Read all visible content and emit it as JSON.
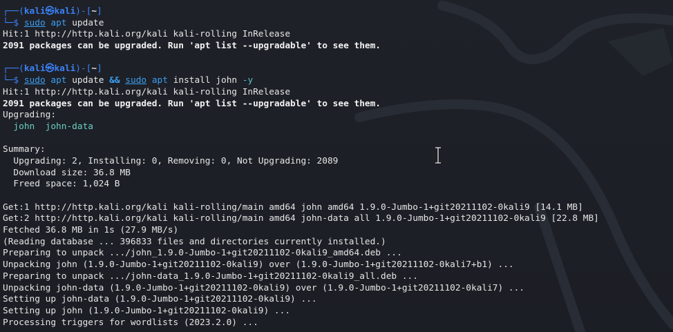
{
  "prompt1": {
    "frame_top": "┌──(",
    "user": "kali",
    "at": "㉿",
    "host": "kali",
    "mid": ")-[",
    "cwd": "~",
    "end": "]",
    "frame_bottom": "└─$ ",
    "sudo": "sudo",
    "apt": "apt",
    "args": "update"
  },
  "block1": [
    "Hit:1 http://http.kali.org/kali kali-rolling InRelease",
    "2091 packages can be upgraded. Run 'apt list --upgradable' to see them."
  ],
  "prompt2": {
    "frame_top": "┌──(",
    "user": "kali",
    "at": "㉿",
    "host": "kali",
    "mid": ")-[",
    "cwd": "~",
    "end": "]",
    "frame_bottom": "└─$ ",
    "sudo1": "sudo",
    "apt1": "apt",
    "args1": " update ",
    "op": "&&",
    "sudo2": "sudo",
    "apt2": "apt",
    "args2": " install john ",
    "flag": "-y"
  },
  "block2": {
    "hit": "Hit:1 http://http.kali.org/kali kali-rolling InRelease",
    "upgradable": "2091 packages can be upgraded. Run 'apt list --upgradable' to see them.",
    "upgrading_label": "Upgrading:",
    "upgrading_pkgs": "  john  john-data",
    "summary_label": "Summary:",
    "summary_lines": [
      "  Upgrading: 2, Installing: 0, Removing: 0, Not Upgrading: 2089",
      "  Download size: 36.8 MB",
      "  Freed space: 1,024 B"
    ],
    "output_lines": [
      "Get:1 http://http.kali.org/kali kali-rolling/main amd64 john amd64 1.9.0-Jumbo-1+git20211102-0kali9 [14.1 MB]",
      "Get:2 http://http.kali.org/kali kali-rolling/main amd64 john-data all 1.9.0-Jumbo-1+git20211102-0kali9 [22.8 MB]",
      "Fetched 36.8 MB in 1s (27.9 MB/s)",
      "(Reading database ... 396833 files and directories currently installed.)",
      "Preparing to unpack .../john_1.9.0-Jumbo-1+git20211102-0kali9_amd64.deb ...",
      "Unpacking john (1.9.0-Jumbo-1+git20211102-0kali9) over (1.9.0-Jumbo-1+git20211102-0kali7+b1) ...",
      "Preparing to unpack .../john-data_1.9.0-Jumbo-1+git20211102-0kali9_all.deb ...",
      "Unpacking john-data (1.9.0-Jumbo-1+git20211102-0kali9) over (1.9.0-Jumbo-1+git20211102-0kali7) ...",
      "Setting up john-data (1.9.0-Jumbo-1+git20211102-0kali9) ...",
      "Setting up john (1.9.0-Jumbo-1+git20211102-0kali9) ...",
      "Processing triggers for wordlists (2023.2.0) ..."
    ]
  },
  "colors": {
    "background": "#1e2128",
    "prompt_blue": "#3b82f6",
    "command_blue": "#3c9ff2",
    "package_cyan": "#6ad0c6"
  },
  "icons": {
    "watermark": "kali-dragon-watermark",
    "cursor": "text-ibeam-cursor"
  }
}
